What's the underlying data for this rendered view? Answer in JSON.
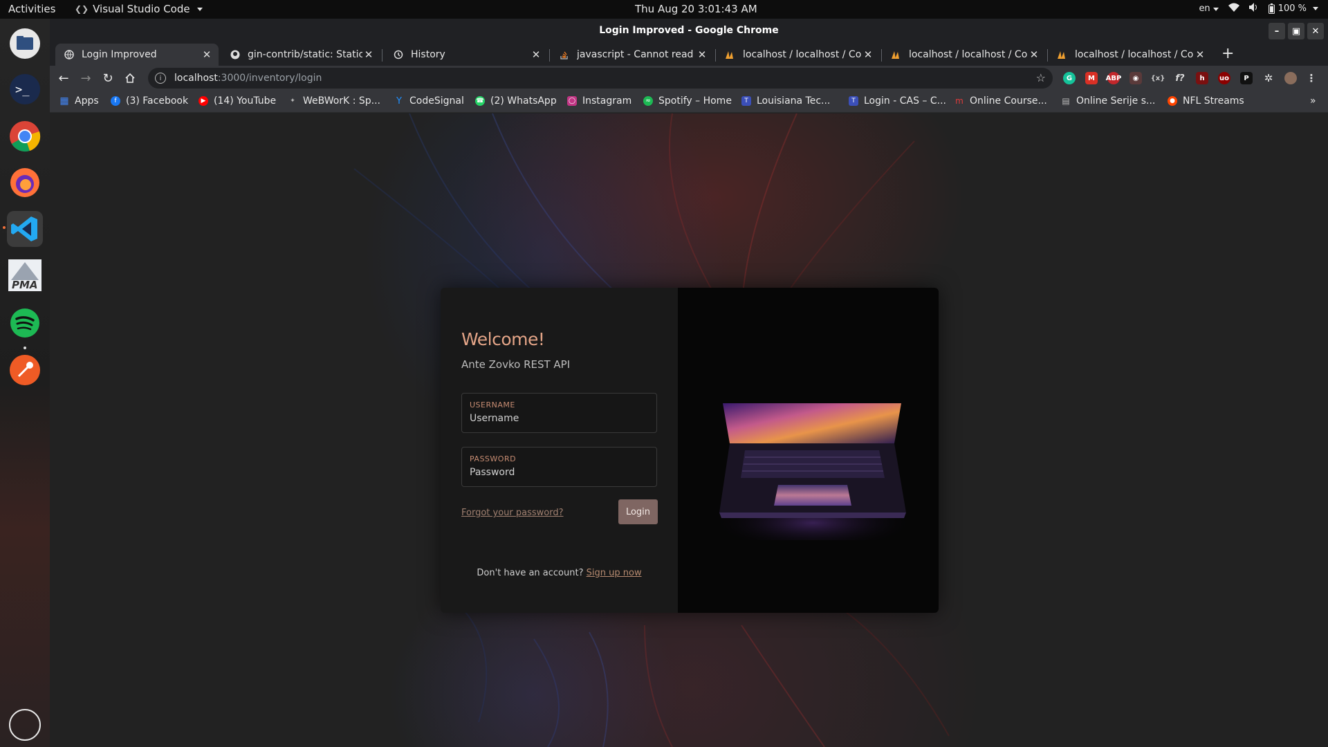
{
  "topbar": {
    "activities": "Activities",
    "app_menu": "Visual Studio Code",
    "clock": "Thu Aug 20  3:01:43 AM",
    "language": "en",
    "battery": "100 %"
  },
  "dock": {
    "items": [
      {
        "name": "files-icon"
      },
      {
        "name": "terminal-icon",
        "glyph": ">_"
      },
      {
        "name": "chrome-icon"
      },
      {
        "name": "firefox-icon"
      },
      {
        "name": "vscode-icon"
      },
      {
        "name": "phpmyadmin-icon",
        "glyph": "PMA"
      },
      {
        "name": "spotify-icon"
      },
      {
        "name": "postman-icon"
      },
      {
        "name": "show-apps-icon"
      }
    ]
  },
  "window": {
    "title": "Login Improved - Google Chrome"
  },
  "tabs": [
    {
      "title": "Login Improved",
      "icon": "globe-icon"
    },
    {
      "title": "gin-contrib/static: Static m",
      "icon": "github-icon"
    },
    {
      "title": "History",
      "icon": "history-icon"
    },
    {
      "title": "javascript - Cannot read p",
      "icon": "stackoverflow-icon"
    },
    {
      "title": "localhost / localhost / Cor",
      "icon": "phpmyadmin-icon"
    },
    {
      "title": "localhost / localhost / Cor",
      "icon": "phpmyadmin-icon"
    },
    {
      "title": "localhost / localhost / Cor",
      "icon": "phpmyadmin-icon"
    }
  ],
  "address": {
    "host": "localhost",
    "path": ":3000/inventory/login"
  },
  "bookmarks": [
    {
      "label": "Apps",
      "color": "#4285f4"
    },
    {
      "label": "(3) Facebook",
      "color": "#1877f2"
    },
    {
      "label": "(14) YouTube",
      "color": "#ff0000"
    },
    {
      "label": "WeBWorK : Sp...",
      "color": "#888888"
    },
    {
      "label": "CodeSignal",
      "color": "#1f8fff"
    },
    {
      "label": "(2) WhatsApp",
      "color": "#25d366"
    },
    {
      "label": "Instagram",
      "color": "#c13584"
    },
    {
      "label": "Spotify – Home",
      "color": "#1db954"
    },
    {
      "label": "Louisiana Tec...",
      "color": "#3b4fb8"
    },
    {
      "label": "Login - CAS – C...",
      "color": "#3b4fb8"
    },
    {
      "label": "Online Course...",
      "color": "#e23b3b"
    },
    {
      "label": "Online Serije s...",
      "color": "#777777"
    },
    {
      "label": "NFL Streams",
      "color": "#ff4500"
    }
  ],
  "login": {
    "welcome": "Welcome!",
    "subtitle": "Ante Zovko REST API",
    "username_label": "USERNAME",
    "username_placeholder": "Username",
    "password_label": "PASSWORD",
    "password_placeholder": "Password",
    "forgot": "Forgot your password?",
    "login_button": "Login",
    "no_account": "Don't have an account?",
    "signup": "Sign up now"
  },
  "colors": {
    "accent": "#e3a487",
    "button": "#7f6662"
  }
}
